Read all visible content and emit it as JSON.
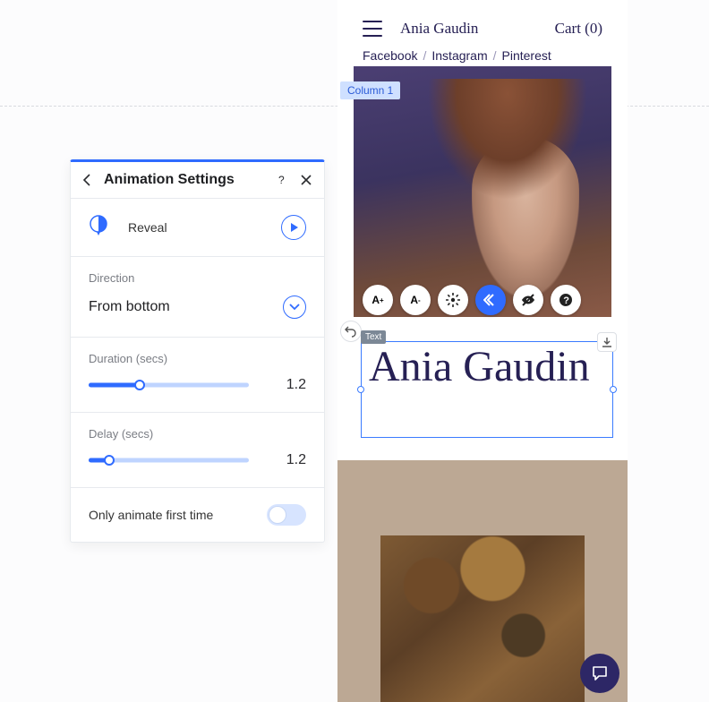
{
  "panel": {
    "title": "Animation Settings",
    "effect_label": "Reveal",
    "direction_label": "Direction",
    "direction_value": "From bottom",
    "duration_label": "Duration (secs)",
    "duration_value": "1.2",
    "duration_pct": 32,
    "delay_label": "Delay (secs)",
    "delay_value": "1.2",
    "delay_pct": 13,
    "first_time_label": "Only animate first time"
  },
  "device": {
    "brand": "Ania Gaudin",
    "cart": "Cart (0)",
    "socials": [
      "Facebook",
      "Instagram",
      "Pinterest"
    ],
    "hero_title": "Ania Gaudin"
  },
  "editor": {
    "column_badge": "Column 1",
    "text_badge": "Text"
  }
}
